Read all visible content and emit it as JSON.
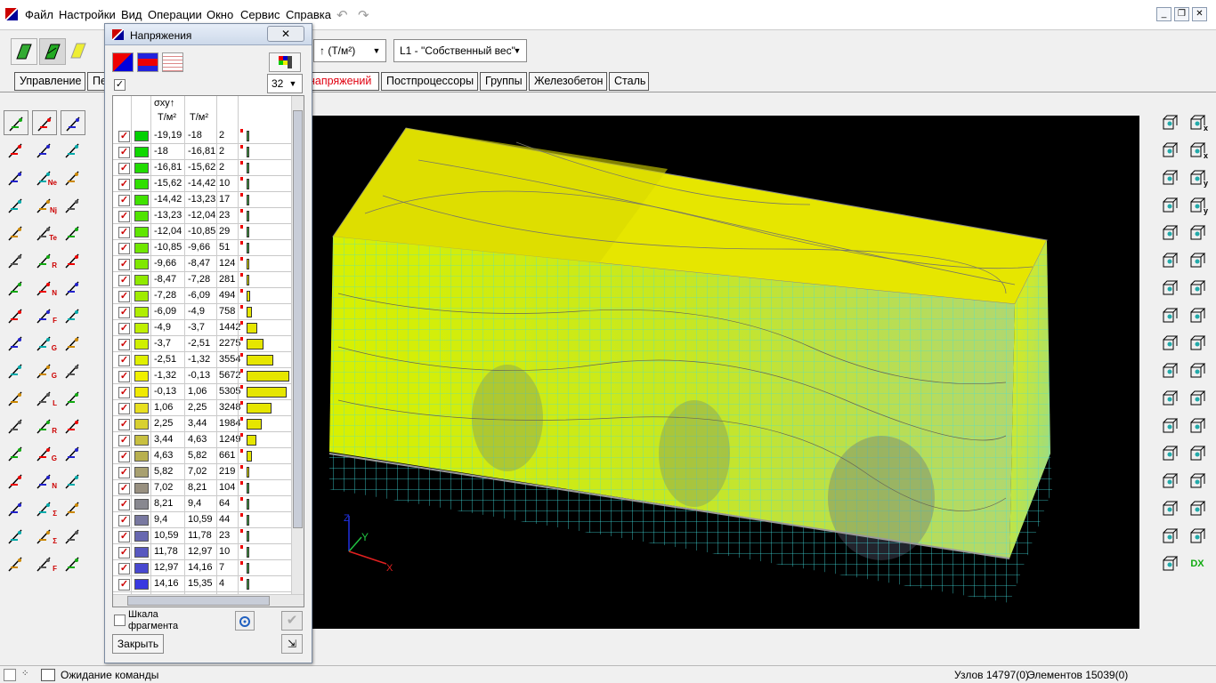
{
  "menu": {
    "items": [
      "Файл",
      "Настройки",
      "Вид",
      "Операции",
      "Окно",
      "Сервис",
      "Справка"
    ]
  },
  "toolbar": {
    "units_combo": "↑ (Т/м²)",
    "load_combo": "L1 - \"Собственный вес\""
  },
  "tabs": [
    {
      "label": "Управление",
      "active": false
    },
    {
      "label": "Пе",
      "active": false
    },
    {
      "label": "напряжений",
      "active": true
    },
    {
      "label": "Постпроцессоры",
      "active": false
    },
    {
      "label": "Группы",
      "active": false
    },
    {
      "label": "Железобетон",
      "active": false
    },
    {
      "label": "Сталь",
      "active": false
    }
  ],
  "dialog": {
    "title": "Напряжения",
    "close_glyph": "✕",
    "scale_count": "32",
    "column_header": "σxy↑",
    "unit1": "Т/м²",
    "unit2": "Т/м²",
    "scale_fragment_label": "Шкала фрагмента",
    "close_button": "Закрыть"
  },
  "scale_rows": [
    {
      "from": "-19,19",
      "to": "-18",
      "count": "2",
      "color": "#00d000",
      "share": 0.0004
    },
    {
      "from": "-18",
      "to": "-16,81",
      "count": "2",
      "color": "#10d800",
      "share": 0.0004
    },
    {
      "from": "-16,81",
      "to": "-15,62",
      "count": "2",
      "color": "#20dc00",
      "share": 0.0004
    },
    {
      "from": "-15,62",
      "to": "-14,42",
      "count": "10",
      "color": "#30e000",
      "share": 0.0018
    },
    {
      "from": "-14,42",
      "to": "-13,23",
      "count": "17",
      "color": "#40e200",
      "share": 0.003
    },
    {
      "from": "-13,23",
      "to": "-12,04",
      "count": "23",
      "color": "#50e400",
      "share": 0.004
    },
    {
      "from": "-12,04",
      "to": "-10,85",
      "count": "29",
      "color": "#60e600",
      "share": 0.005
    },
    {
      "from": "-10,85",
      "to": "-9,66",
      "count": "51",
      "color": "#70e800",
      "share": 0.009
    },
    {
      "from": "-9,66",
      "to": "-8,47",
      "count": "124",
      "color": "#80e800",
      "share": 0.022
    },
    {
      "from": "-8,47",
      "to": "-7,28",
      "count": "281",
      "color": "#90ea00",
      "share": 0.05
    },
    {
      "from": "-7,28",
      "to": "-6,09",
      "count": "494",
      "color": "#a0ec00",
      "share": 0.087
    },
    {
      "from": "-6,09",
      "to": "-4,9",
      "count": "758",
      "color": "#b0ee00",
      "share": 0.134
    },
    {
      "from": "-4,9",
      "to": "-3,7",
      "count": "1442",
      "color": "#c0f000",
      "share": 0.254
    },
    {
      "from": "-3,7",
      "to": "-2,51",
      "count": "2275",
      "color": "#d0f000",
      "share": 0.401
    },
    {
      "from": "-2,51",
      "to": "-1,32",
      "count": "3554",
      "color": "#e0f000",
      "share": 0.627
    },
    {
      "from": "-1,32",
      "to": "-0,13",
      "count": "5672",
      "color": "#f0f000",
      "share": 1
    },
    {
      "from": "-0,13",
      "to": "1,06",
      "count": "5305",
      "color": "#f0ea00",
      "share": 0.935
    },
    {
      "from": "1,06",
      "to": "2,25",
      "count": "3248",
      "color": "#e8e020",
      "share": 0.573
    },
    {
      "from": "2,25",
      "to": "3,44",
      "count": "1984",
      "color": "#d8d030",
      "share": 0.35
    },
    {
      "from": "3,44",
      "to": "4,63",
      "count": "1249",
      "color": "#c8c040",
      "share": 0.22
    },
    {
      "from": "4,63",
      "to": "5,82",
      "count": "661",
      "color": "#b8b050",
      "share": 0.117
    },
    {
      "from": "5,82",
      "to": "7,02",
      "count": "219",
      "color": "#a8a070",
      "share": 0.039
    },
    {
      "from": "7,02",
      "to": "8,21",
      "count": "104",
      "color": "#989080",
      "share": 0.018
    },
    {
      "from": "8,21",
      "to": "9,4",
      "count": "64",
      "color": "#888890",
      "share": 0.011
    },
    {
      "from": "9,4",
      "to": "10,59",
      "count": "44",
      "color": "#7878a0",
      "share": 0.008
    },
    {
      "from": "10,59",
      "to": "11,78",
      "count": "23",
      "color": "#6868b0",
      "share": 0.004
    },
    {
      "from": "11,78",
      "to": "12,97",
      "count": "10",
      "color": "#5858c0",
      "share": 0.0018
    },
    {
      "from": "12,97",
      "to": "14,16",
      "count": "7",
      "color": "#4848d0",
      "share": 0.0012
    },
    {
      "from": "14,16",
      "to": "15,35",
      "count": "4",
      "color": "#3838e0",
      "share": 0.0007
    }
  ],
  "axes": {
    "z": "Z",
    "y": "Y",
    "x": "X"
  },
  "status": {
    "message": "Ожидание команды",
    "nodes": "Узлов 14797(0)",
    "elements": "Элементов 15039(0)"
  },
  "left_icon_labels": [
    "Ne",
    "Nj",
    "Te",
    "R",
    "N",
    "F",
    "G",
    "G",
    "L",
    "R",
    "G",
    "N",
    "Σ",
    "Σ",
    "F"
  ],
  "right_icon_labels": [
    "x",
    "x",
    "y",
    "y",
    "DX"
  ]
}
